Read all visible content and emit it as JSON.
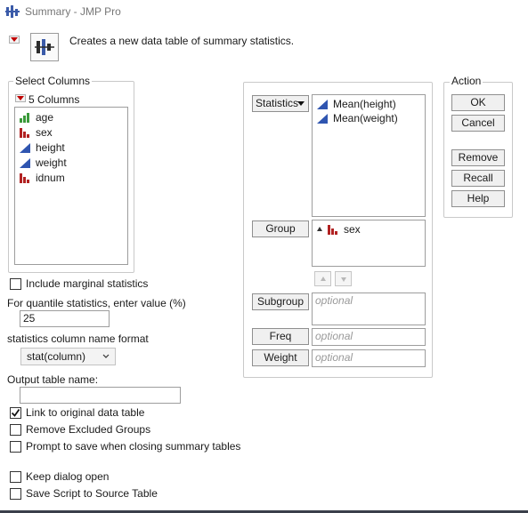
{
  "window": {
    "title": "Summary - JMP Pro"
  },
  "description": "Creates a new data table of summary statistics.",
  "select_columns": {
    "label": "Select Columns",
    "count_label": "5 Columns",
    "columns": [
      {
        "name": "age",
        "type": "ordinal-icon"
      },
      {
        "name": "sex",
        "type": "nominal-icon"
      },
      {
        "name": "height",
        "type": "continuous-icon"
      },
      {
        "name": "weight",
        "type": "continuous-icon"
      },
      {
        "name": "idnum",
        "type": "nominal-icon"
      }
    ]
  },
  "options": {
    "include_marginal": {
      "label": "Include marginal statistics",
      "checked": false
    },
    "quantile_label": "For quantile statistics, enter value (%)",
    "quantile_value": "25",
    "name_format_label": "statistics column name format",
    "name_format_value": "stat(column)",
    "output_name_label": "Output table name:",
    "output_name_value": "",
    "link_original": {
      "label": "Link to original data table",
      "checked": true
    },
    "remove_excluded": {
      "label": "Remove Excluded Groups",
      "checked": false
    },
    "prompt_save": {
      "label": "Prompt to save when closing summary tables",
      "checked": false
    },
    "keep_open": {
      "label": "Keep dialog open",
      "checked": false
    },
    "save_script": {
      "label": "Save Script to Source Table",
      "checked": false
    }
  },
  "roles": {
    "statistics_button": "Statistics",
    "statistics_items": [
      "Mean(height)",
      "Mean(weight)"
    ],
    "group_button": "Group",
    "group_items": [
      "sex"
    ],
    "subgroup_button": "Subgroup",
    "freq_button": "Freq",
    "weight_button": "Weight",
    "optional_placeholder": "optional"
  },
  "action": {
    "label": "Action",
    "ok": "OK",
    "cancel": "Cancel",
    "remove": "Remove",
    "recall": "Recall",
    "help": "Help"
  },
  "colors": {
    "red_triangle": "#c00000",
    "continuous_blue": "#2f55b0",
    "nominal_red": "#b22222",
    "ordinal_green": "#3a9a3a"
  }
}
